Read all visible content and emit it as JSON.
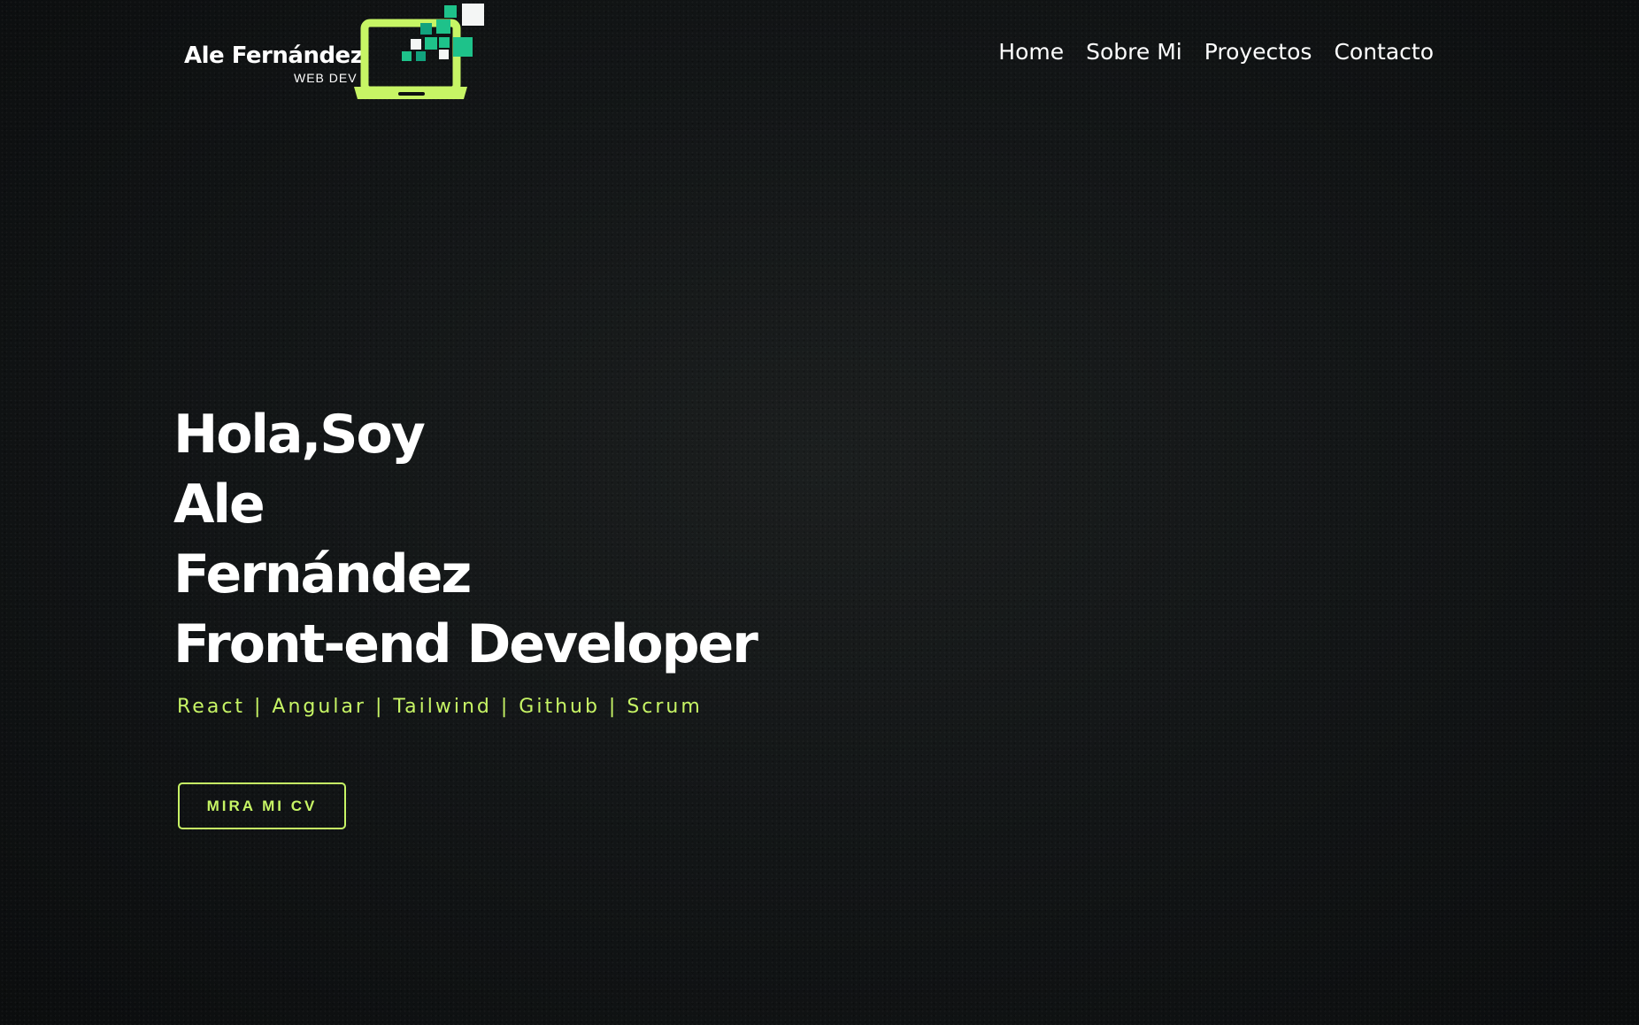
{
  "header": {
    "logo": {
      "name": "Ale Fernández",
      "subtitle": "WEB DEV",
      "icon": "laptop-pixels-icon"
    },
    "nav": [
      {
        "label": "Home"
      },
      {
        "label": "Sobre Mi"
      },
      {
        "label": "Proyectos"
      },
      {
        "label": "Contacto"
      }
    ]
  },
  "hero": {
    "lines": [
      "Hola,Soy",
      "Ale",
      "Fernández",
      "Front-end Developer"
    ],
    "skills": "React | Angular | Tailwind | Github | Scrum",
    "cta_label": "MIRA MI CV"
  },
  "colors": {
    "accent": "#c7f565",
    "background": "#131617",
    "text": "#ffffff",
    "teal": "#1ec28a",
    "teal_dark": "#12a37e"
  }
}
